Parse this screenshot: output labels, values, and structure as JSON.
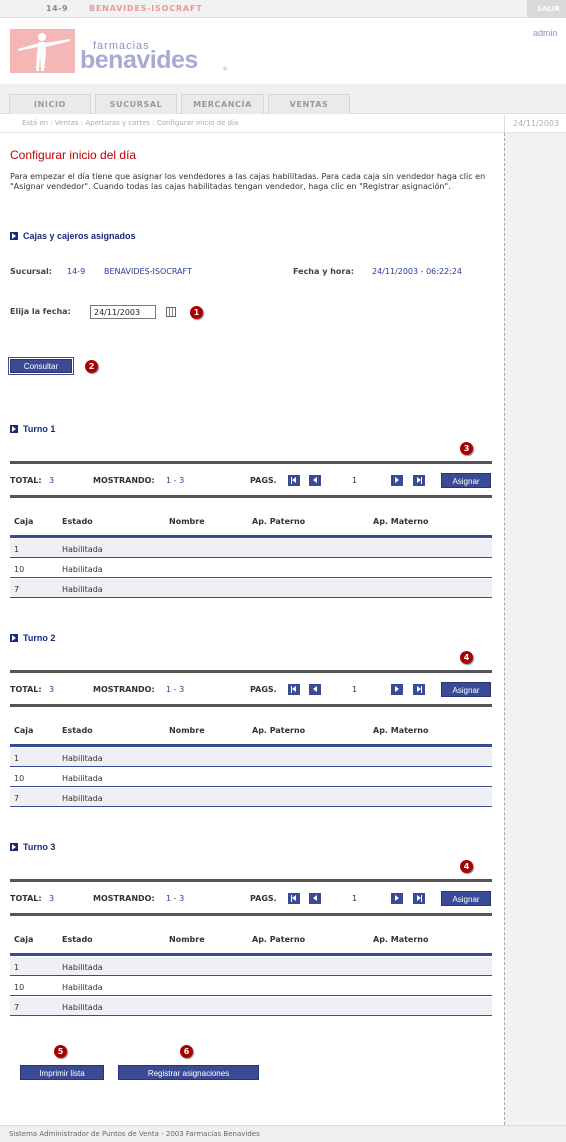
{
  "top": {
    "store_code": "14-9",
    "store_name": "BENAVIDES-ISOCRAFT",
    "salir": "SALIR"
  },
  "header": {
    "logo_small": "farmacias",
    "logo_big": "benavides",
    "logo_r": "®",
    "user": "admin"
  },
  "nav": {
    "tabs": [
      "INICIO",
      "SUCURSAL",
      "MERCANCÍA",
      "VENTAS"
    ]
  },
  "breadcrumb": {
    "text": "Está en : Ventas : Aperturas y cortes : Configurar inicio de día",
    "date": "24/11/2003"
  },
  "page": {
    "title": "Configurar inicio del día",
    "intro": "Para empezar el día tiene que asignar los vendedores a las cajas habilitadas. Para cada caja sin vendedor haga clic en \"Asignar vendedor\". Cuando todas las cajas habilitadas tengan vendedor, haga clic en \"Registrar asignación\"."
  },
  "assigned": {
    "heading": "Cajas y cajeros asignados",
    "sucursal_label": "Sucursal:",
    "sucursal_code": "14-9",
    "sucursal_name": "BENAVIDES-ISOCRAFT",
    "fecha_label": "Fecha y hora:",
    "fecha_value": "24/11/2003 - 06:22:24",
    "elija_label": "Elija la fecha:",
    "date_value": "24/11/2003",
    "consultar": "Consultar"
  },
  "bullets": [
    "1",
    "2",
    "3",
    "4",
    "4",
    "5",
    "6"
  ],
  "pager": {
    "total_label": "TOTAL:",
    "mostrando_label": "MOSTRANDO:",
    "pags_label": "PAGS.",
    "asignar": "Asignar"
  },
  "columns": [
    "Caja",
    "Estado",
    "Nombre",
    "Ap. Paterno",
    "Ap. Materno"
  ],
  "turnos": [
    {
      "title": "Turno 1",
      "total": "3",
      "mostrando": "1 - 3",
      "page": "1",
      "rows": [
        {
          "caja": "1",
          "estado": "Habilitada"
        },
        {
          "caja": "10",
          "estado": "Habilitada"
        },
        {
          "caja": "7",
          "estado": "Habilitada"
        }
      ]
    },
    {
      "title": "Turno 2",
      "total": "3",
      "mostrando": "1 - 3",
      "page": "1",
      "rows": [
        {
          "caja": "1",
          "estado": "Habilitada"
        },
        {
          "caja": "10",
          "estado": "Habilitada"
        },
        {
          "caja": "7",
          "estado": "Habilitada"
        }
      ]
    },
    {
      "title": "Turno 3",
      "total": "3",
      "mostrando": "1 - 3",
      "page": "1",
      "rows": [
        {
          "caja": "1",
          "estado": "Habilitada"
        },
        {
          "caja": "10",
          "estado": "Habilitada"
        },
        {
          "caja": "7",
          "estado": "Habilitada"
        }
      ]
    }
  ],
  "actions": {
    "imprimir": "Imprimir lista",
    "registrar": "Registrar asignaciones"
  },
  "footer": {
    "text": "Sistema Administrador de Puntos de Venta - 2003 Farmacias Benavides"
  }
}
